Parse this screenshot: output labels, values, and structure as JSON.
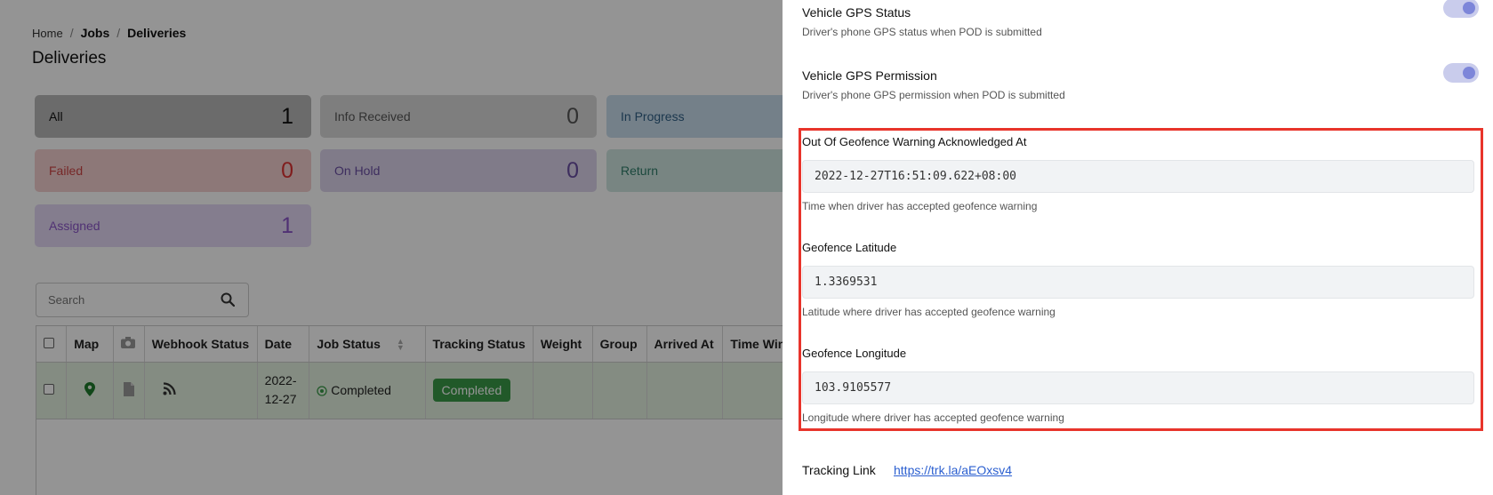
{
  "breadcrumb": {
    "home": "Home",
    "jobs": "Jobs",
    "current": "Deliveries"
  },
  "page_title": "Deliveries",
  "stats": [
    {
      "label": "All",
      "count": "1"
    },
    {
      "label": "Info Received",
      "count": "0"
    },
    {
      "label": "In Progress",
      "count": ""
    },
    {
      "label": "Failed",
      "count": "0"
    },
    {
      "label": "On Hold",
      "count": "0"
    },
    {
      "label": "Return",
      "count": ""
    },
    {
      "label": "Assigned",
      "count": "1"
    }
  ],
  "search": {
    "placeholder": "Search"
  },
  "table": {
    "headers": [
      "Map",
      "Webhook Status",
      "Date",
      "Job Status",
      "Tracking Status",
      "Weight",
      "Group",
      "Arrived At",
      "Time Win"
    ],
    "row": {
      "date_line1": "2022-",
      "date_line2": "12-27",
      "job_status": "Completed",
      "tracking_status": "Completed"
    }
  },
  "drawer": {
    "gps_status": {
      "title": "Vehicle GPS Status",
      "desc": "Driver's phone GPS status when POD is submitted"
    },
    "gps_permission": {
      "title": "Vehicle GPS Permission",
      "desc": "Driver's phone GPS permission when POD is submitted"
    },
    "fields": [
      {
        "label": "Out Of Geofence Warning Acknowledged At",
        "value": "2022-12-27T16:51:09.622+08:00",
        "hint": "Time when driver has accepted geofence warning"
      },
      {
        "label": "Geofence Latitude",
        "value": "1.3369531",
        "hint": "Latitude where driver has accepted geofence warning"
      },
      {
        "label": "Geofence Longitude",
        "value": "103.9105577",
        "hint": "Longitude where driver has accepted geofence warning"
      }
    ],
    "tracking": {
      "label": "Tracking Link",
      "url": "https://trk.la/aEOxsv4"
    }
  },
  "colors": {
    "highlight": "#e8342b",
    "toggle": "#7d86d9",
    "completed": "#3a9a48",
    "link": "#2b5fd0"
  }
}
